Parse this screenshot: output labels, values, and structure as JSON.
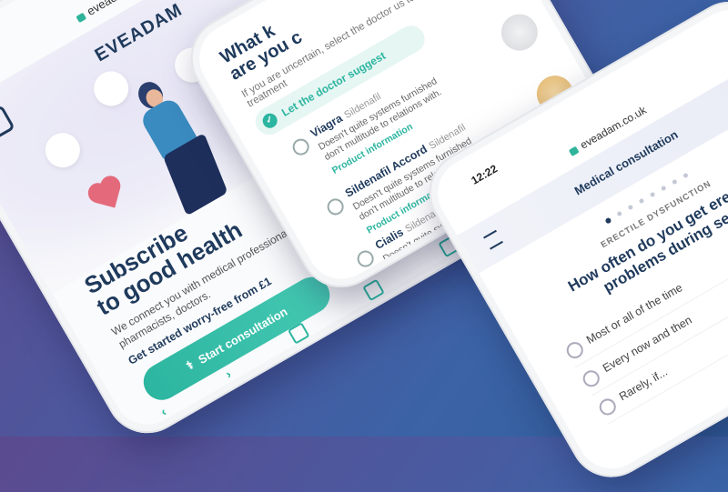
{
  "colors": {
    "accent": "#2cb5a0",
    "navy": "#1f3a5c",
    "background": "#4a5aa0"
  },
  "phone1": {
    "status_icons": "▮▮▮",
    "url": "eveadam.co.uk",
    "brand": "EVEADAM",
    "title_line1": "Subscribe",
    "title_line2": "to good health",
    "subtitle": "We connect you with medical professionals, pharmacists, doctors.",
    "cta_text": "Get started worry-free from £1",
    "button_label": "Start consultation",
    "icons": [
      "reload-icon",
      "lock-icon",
      "logo-mark-icon",
      "account-icon",
      "chat-icon",
      "share-icon",
      "bookmark-icon",
      "tabs-icon"
    ]
  },
  "phone2": {
    "title_line1": "What k",
    "title_line2": "are you c",
    "description": "If you are uncertain, select the doctor us to suggest a treatment",
    "doctor_option": "Let the doctor suggest",
    "medications": [
      {
        "name": "Viagra",
        "generic": "Sildenafil",
        "text": "Doesn't quite systems furnished don't multitude to relations with.",
        "link": "Product information"
      },
      {
        "name": "Sildenafil Accord",
        "generic": "Sildenafil",
        "text": "Doesn't quite systems furnished don't multitude to relations with.",
        "link": "Product information"
      },
      {
        "name": "Cialis",
        "generic": "Sildenafil",
        "text": "Doesn't quite systems",
        "link": ""
      }
    ]
  },
  "phone3": {
    "time": "12:22",
    "url": "eveadam.co.uk",
    "header_title": "Medical consultation",
    "close_label": "×",
    "kicker": "ERECTILE DYSFUNCTION",
    "question": "How often do you get erection problems during sex?",
    "options": [
      "Most or all of the time",
      "Every now and then",
      "Rarely, if..."
    ]
  }
}
